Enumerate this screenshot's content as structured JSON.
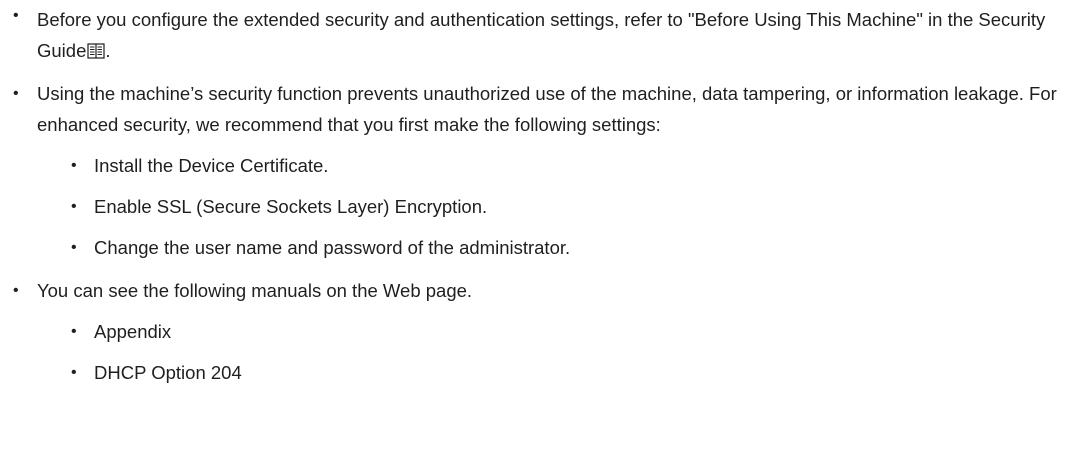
{
  "bullet_glyph": "•",
  "items": {
    "before_using": {
      "text": "Before you configure the extended security and authentication settings, refer to \"Before Using This Machine\" in the Security Guide",
      "trailing": ".",
      "icon": "book-icon"
    },
    "security_function": {
      "text": "Using the machine’s security function prevents unauthorized use of the machine, data tampering, or information leakage. For enhanced security, we recommend that you first make the following settings:",
      "subitems": [
        "Install the Device Certificate.",
        "Enable SSL (Secure Sockets Layer) Encryption.",
        "Change the user name and password of the administrator."
      ]
    },
    "manuals": {
      "text": "You can see the following manuals on the Web page.",
      "subitems": [
        "Appendix",
        "DHCP Option 204"
      ]
    }
  }
}
